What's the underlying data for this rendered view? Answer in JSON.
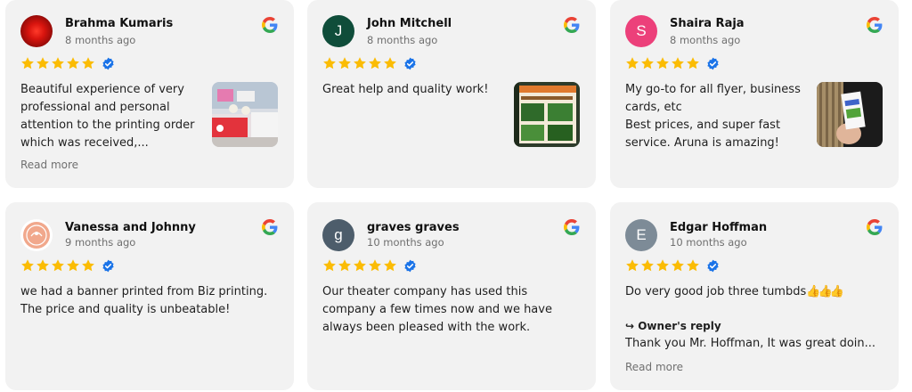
{
  "reviews": [
    {
      "name": "Brahma Kumaris",
      "date": "8 months ago",
      "avatar_color": "#c8150f",
      "avatar_letter": "",
      "text": [
        "Beautiful experience of very",
        "professional and personal",
        "attention to the printing order",
        "which was received,..."
      ],
      "read_more": "Read more",
      "has_photo": true
    },
    {
      "name": "John Mitchell",
      "date": "8 months ago",
      "avatar_color": "#0f4d3a",
      "avatar_letter": "J",
      "text": [
        "Great help and quality work!"
      ],
      "has_photo": true
    },
    {
      "name": "Shaira Raja",
      "date": "8 months ago",
      "avatar_color": "#ec407a",
      "avatar_letter": "S",
      "text": [
        "My go-to for all flyer, business",
        "cards, etc",
        "Best prices, and super fast",
        "service. Aruna is amazing!"
      ],
      "has_photo": true
    },
    {
      "name": "Vanessa and Johnny",
      "date": "9 months ago",
      "avatar_color": "#e9886a",
      "avatar_letter": "",
      "text": [
        "we had a banner printed from Biz printing.",
        "The price and quality is unbeatable!"
      ]
    },
    {
      "name": "graves graves",
      "date": "10 months ago",
      "avatar_color": "#4d5d6b",
      "avatar_letter": "g",
      "text": [
        "Our theater company has used this",
        "company a few times now and we have",
        "always been pleased with the work."
      ]
    },
    {
      "name": "Edgar Hoffman",
      "date": "10 months ago",
      "avatar_color": "#7d8b97",
      "avatar_letter": "E",
      "text": [
        "Do very good job three tumbds"
      ],
      "emoji": "👍👍👍",
      "owner_reply_label": "↪ Owner's reply",
      "owner_reply_text": "Thank you Mr. Hoffman, It was great doin...",
      "read_more": "Read more"
    }
  ],
  "colors": {
    "star": "#fbbc04",
    "verified": "#1a73e8",
    "card_bg": "#f2f2f2"
  },
  "icons": {
    "source": "google-g-icon",
    "rating": "star-icon",
    "badge": "verified-badge-icon"
  }
}
